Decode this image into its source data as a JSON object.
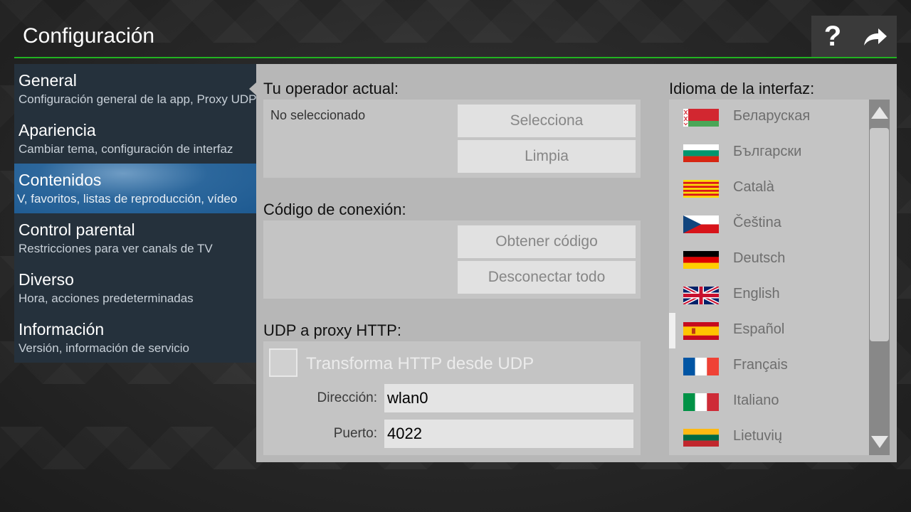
{
  "header": {
    "title": "Configuración",
    "help_label": "?"
  },
  "sidebar": {
    "items": [
      {
        "title": "General",
        "subtitle": "Configuración general de la app, Proxy UDP"
      },
      {
        "title": "Apariencia",
        "subtitle": "Cambiar tema, configuración de interfaz"
      },
      {
        "title": "Contenidos",
        "subtitle": "V, favoritos, listas de reproducción, vídeo"
      },
      {
        "title": "Control parental",
        "subtitle": "Restricciones para ver canals de TV"
      },
      {
        "title": "Diverso",
        "subtitle": "Hora, acciones predeterminadas"
      },
      {
        "title": "Información",
        "subtitle": "Versión, información de servicio"
      }
    ],
    "active_index": 2
  },
  "operator": {
    "label": "Tu operador actual:",
    "status": "No seleccionado",
    "select_button": "Selecciona",
    "clear_button": "Limpia"
  },
  "connection": {
    "label": "Código de conexión:",
    "get_code_button": "Obtener código",
    "disconnect_button": "Desconectar todo"
  },
  "udp_proxy": {
    "label": "UDP a proxy HTTP:",
    "checkbox_label": "Transforma HTTP desde UDP",
    "checked": false,
    "address_label": "Dirección:",
    "address_value": "wlan0",
    "port_label": "Puerto:",
    "port_value": "4022"
  },
  "language": {
    "label": "Idioma de la interfaz:",
    "selected": "Español",
    "items": [
      {
        "name": "Беларуская",
        "flag": "by-flag"
      },
      {
        "name": "Български",
        "flag": "bg-flag"
      },
      {
        "name": "Català",
        "flag": "ca-flag"
      },
      {
        "name": "Čeština",
        "flag": "cz-flag"
      },
      {
        "name": "Deutsch",
        "flag": "de-flag"
      },
      {
        "name": "English",
        "flag": "gb-flag"
      },
      {
        "name": "Español",
        "flag": "es-flag"
      },
      {
        "name": "Français",
        "flag": "fr-flag"
      },
      {
        "name": "Italiano",
        "flag": "it-flag"
      },
      {
        "name": "Lietuvių",
        "flag": "lt-flag"
      }
    ]
  },
  "colors": {
    "accent": "#21b321",
    "active_item": "#2c679c",
    "panel": "#b7b7b7"
  }
}
